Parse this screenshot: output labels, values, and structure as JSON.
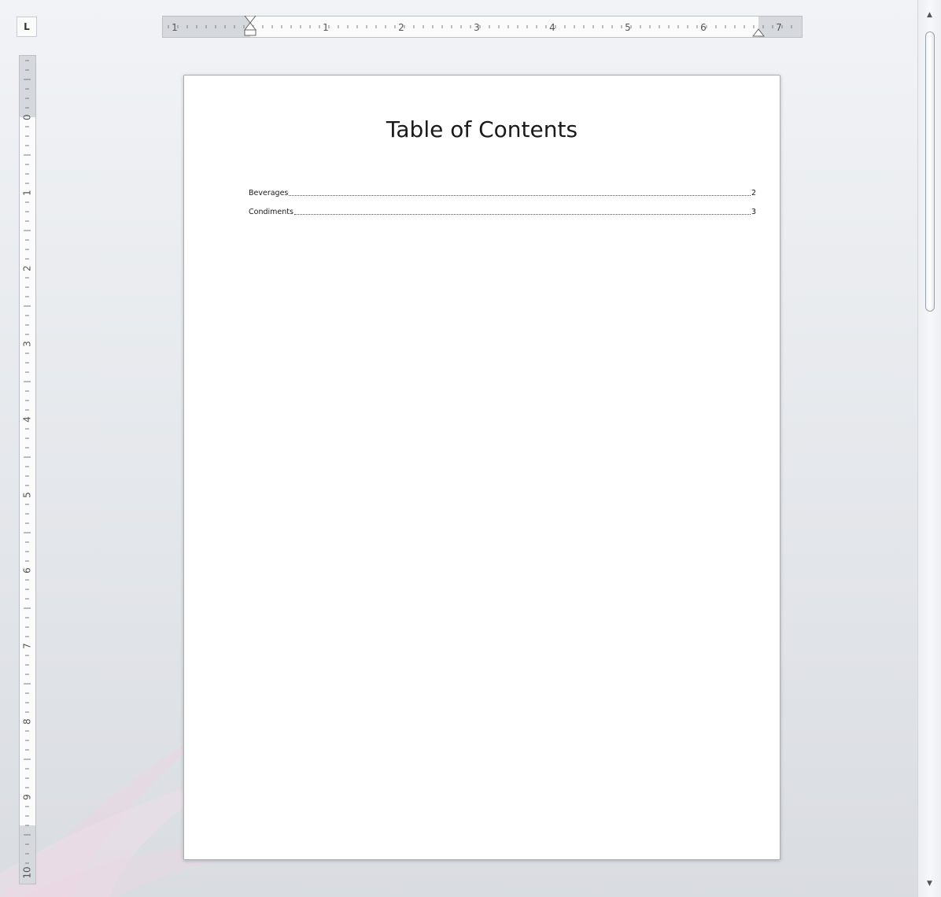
{
  "ruler": {
    "tab_selector_label": "L",
    "horizontal_numbers": [
      "1",
      "1",
      "2",
      "3",
      "4",
      "5",
      "6",
      "7"
    ],
    "vertical_numbers": [
      "0",
      "1",
      "2",
      "3",
      "4",
      "5",
      "6",
      "7",
      "8",
      "9",
      "10"
    ]
  },
  "document": {
    "title": "Table of Contents",
    "entries": [
      {
        "text": "Beverages",
        "page": "2"
      },
      {
        "text": "Condiments",
        "page": "3"
      }
    ]
  },
  "scrollbar": {
    "up_icon": "scroll-up-arrow-icon",
    "down_icon": "scroll-down-arrow-icon",
    "position_fraction": 0.0
  },
  "colors": {
    "page_background": "#ffffff",
    "workspace_background": "#e3e6ea",
    "ruler_gray": "#d5d8dc",
    "ruler_white": "#fbfbfc"
  }
}
